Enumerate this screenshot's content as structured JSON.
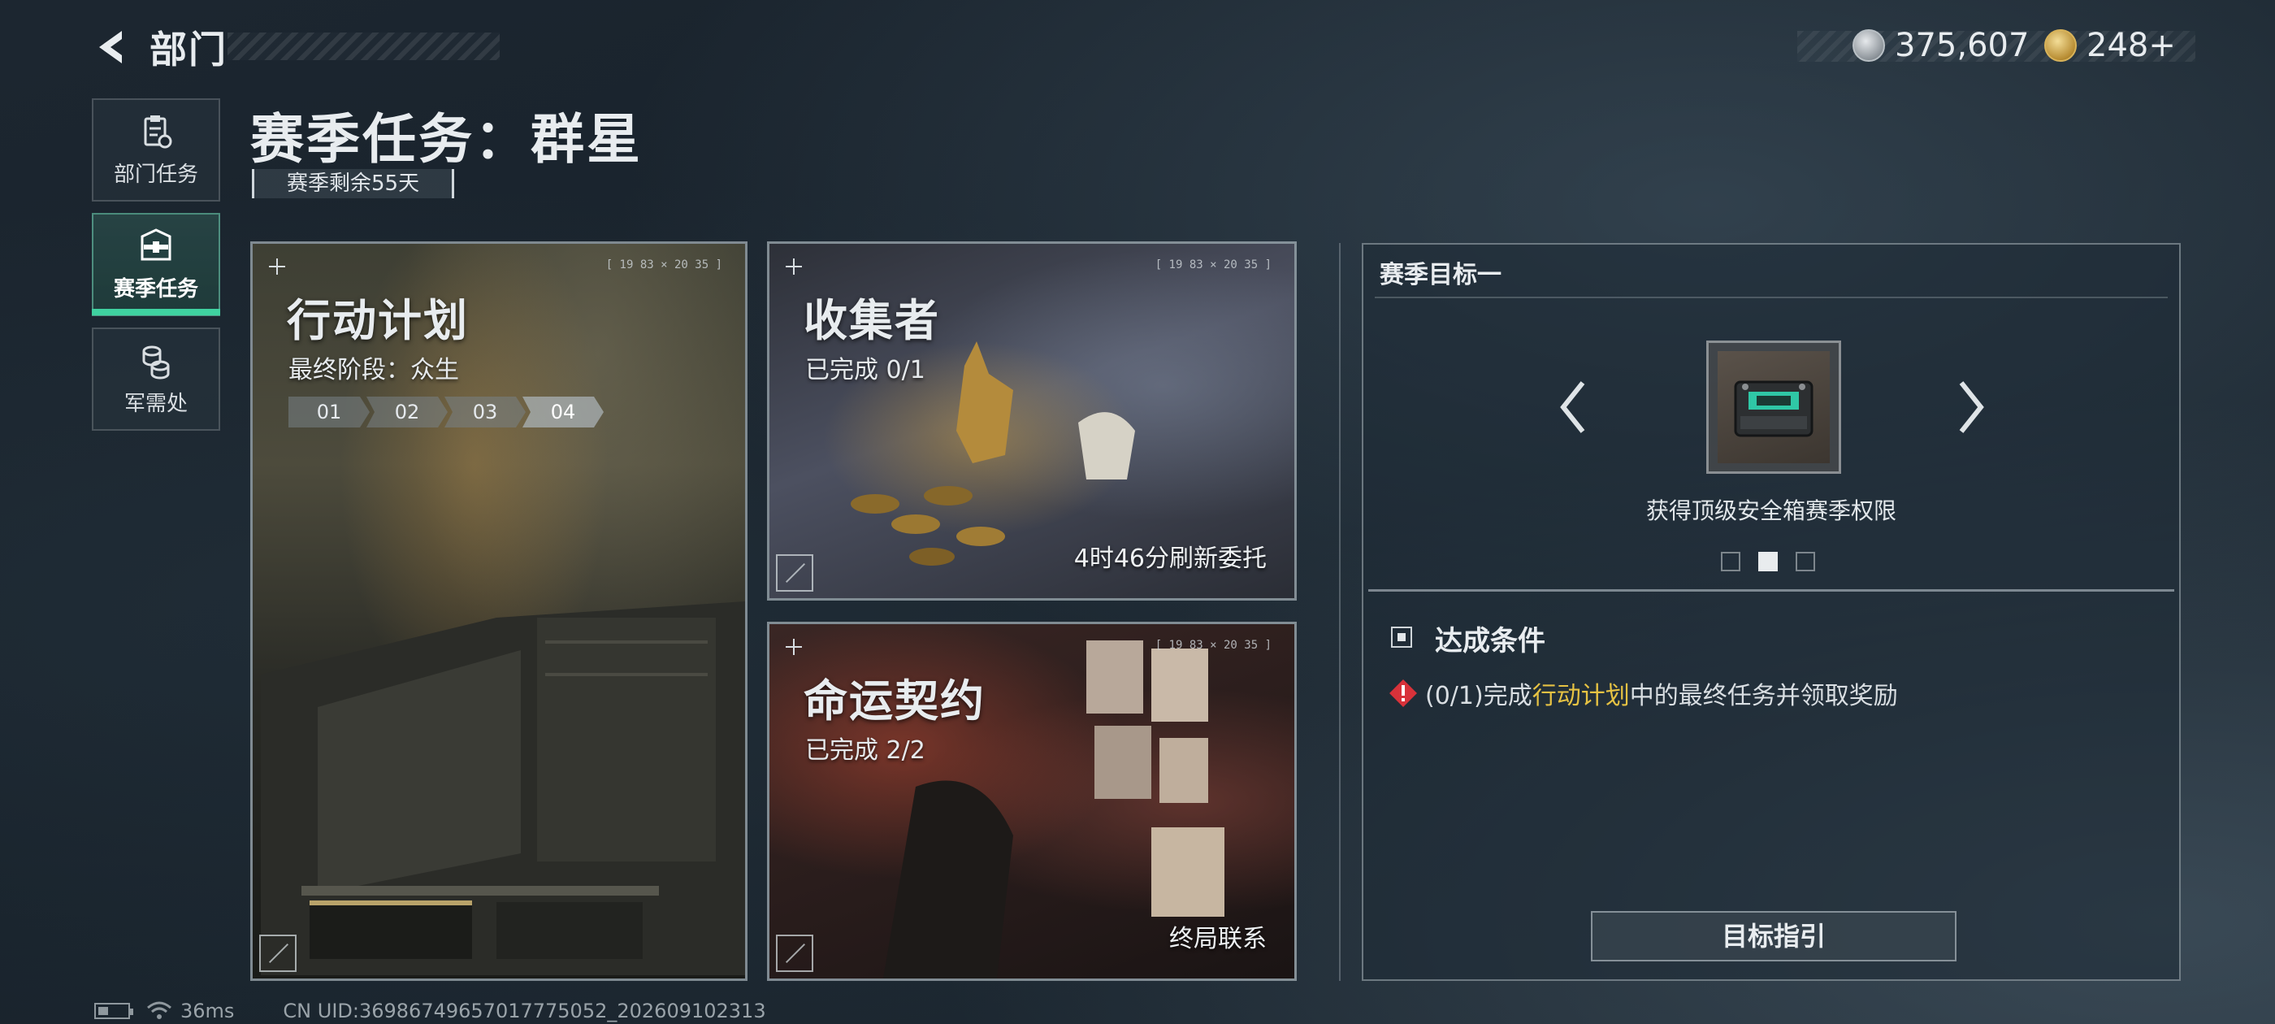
{
  "header": {
    "back_title": "部门",
    "currencies": [
      {
        "icon": "silver-coin-icon",
        "value": "375,607"
      },
      {
        "icon": "gold-coin-icon",
        "value": "248+"
      }
    ]
  },
  "sidebar": {
    "items": [
      {
        "label": "部门任务",
        "icon": "clipboard-icon",
        "active": false
      },
      {
        "label": "赛季任务",
        "icon": "briefcase-icon",
        "active": true
      },
      {
        "label": "军需处",
        "icon": "coin-stack-icon",
        "active": false
      }
    ]
  },
  "page": {
    "title": "赛季任务：群星",
    "remaining": "赛季剩余55天"
  },
  "cards": {
    "plan": {
      "title": "行动计划",
      "subtitle": "最终阶段：众生",
      "tag": "[ 19 83 × 20 35 ]",
      "stages": [
        "01",
        "02",
        "03",
        "04"
      ]
    },
    "collector": {
      "title": "收集者",
      "subtitle": "已完成 0/1",
      "tag": "[ 19 83 × 20 35 ]",
      "footer": "4时46分刷新委托"
    },
    "fate": {
      "title": "命运契约",
      "subtitle": "已完成 2/2",
      "tag": "[ 19 83 × 20 35 ]",
      "footer": "终局联系"
    }
  },
  "goal_panel": {
    "title": "赛季目标一",
    "reward_label": "获得顶级安全箱赛季权限",
    "condition_title": "达成条件",
    "condition_prefix": "(0/1)完成",
    "condition_highlight": "行动计划",
    "condition_suffix": "中的最终任务并领取奖励",
    "guide_button": "目标指引",
    "page_dots": 3,
    "active_dot": 2
  },
  "status_bar": {
    "ping": "36ms",
    "uid": "CN UID:36986749657017775052_202609102313"
  },
  "colors": {
    "accent_green": "#3fd2a0",
    "highlight_yellow": "#e6c243",
    "warning_red": "#d8323a"
  }
}
